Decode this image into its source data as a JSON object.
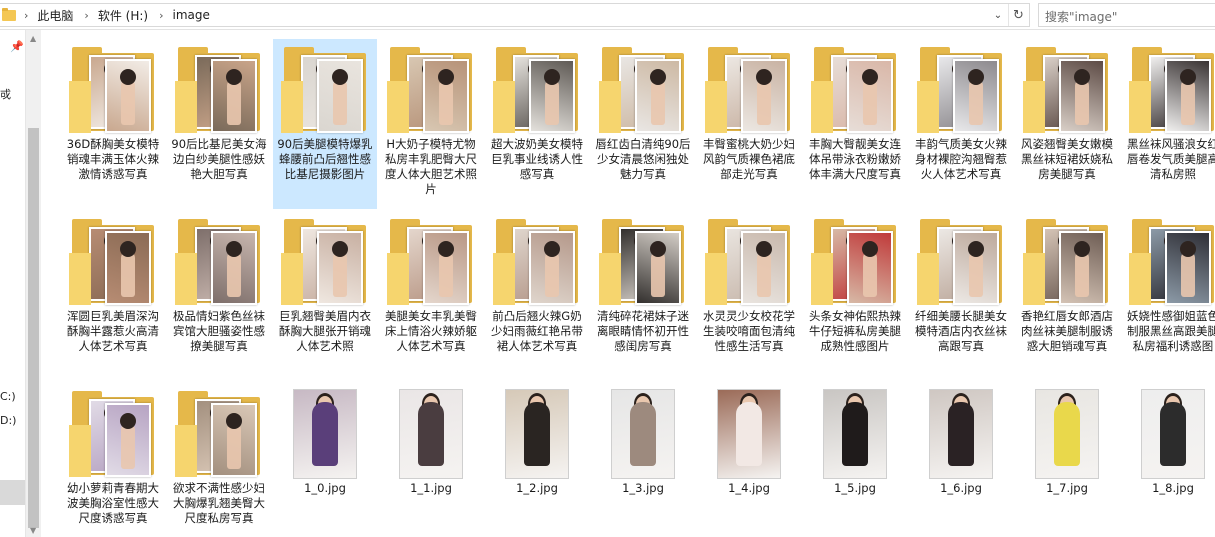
{
  "address": {
    "crumbs": [
      "此电脑",
      "软件 (H:)",
      "image"
    ],
    "search_placeholder": "搜索\"image\""
  },
  "nav": {
    "fragments": [
      {
        "text": "戓"
      },
      {
        "text": "C:)"
      },
      {
        "text": "D:)"
      }
    ]
  },
  "items": [
    {
      "type": "folder",
      "label": "36D酥胸美女模特销魂丰满玉体火辣激情诱惑写真",
      "colors": [
        "#c9a88f",
        "#f2ece6"
      ]
    },
    {
      "type": "folder",
      "label": "90后比基尼美女海边白纱美腿性感妖艳大胆写真",
      "colors": [
        "#7a6a5a",
        "#c9a489"
      ]
    },
    {
      "type": "folder",
      "label": "90后美腿模特爆乳蜂腰前凸后翘性感比基尼摄影图片",
      "colors": [
        "#dad6d0",
        "#e9e4de"
      ],
      "selected": true
    },
    {
      "type": "folder",
      "label": "H大奶子模特尤物私房丰乳肥臀大尺度人体大胆艺术照片",
      "colors": [
        "#d8c7b2",
        "#b79379"
      ]
    },
    {
      "type": "folder",
      "label": "超大波奶美女模特巨乳事业线诱人性感写真",
      "colors": [
        "#e4e1dc",
        "#5f5a55"
      ]
    },
    {
      "type": "folder",
      "label": "唇红齿白清纯90后少女清晨悠闲独处魅力写真",
      "colors": [
        "#e9e6e3",
        "#cdb9a4"
      ]
    },
    {
      "type": "folder",
      "label": "丰臀蜜桃大奶少妇风韵气质裸色裙底部走光写真",
      "colors": [
        "#ece7e2",
        "#c9b3a3"
      ]
    },
    {
      "type": "folder",
      "label": "丰胸大臀靓美女连体吊带泳衣粉嫩娇体丰满大尺度写真",
      "colors": [
        "#e7ddd7",
        "#d9b7a8"
      ]
    },
    {
      "type": "folder",
      "label": "丰韵气质美女火辣身材裸腔沟翘臀惹火人体艺术写真",
      "colors": [
        "#e8e8ea",
        "#8d8a8e"
      ]
    },
    {
      "type": "folder",
      "label": "风姿翘臀美女嫩模黑丝袜短裙妖娆私房美腿写真",
      "colors": [
        "#d9cfc7",
        "#5d4b45"
      ]
    },
    {
      "type": "folder",
      "label": "黑丝袜风骚浪女红唇卷发气质美腿高清私房照",
      "colors": [
        "#f0efee",
        "#3a3434"
      ]
    },
    {
      "type": "folder",
      "label": "浑圆巨乳美眉深沟酥胸半露惹火高清人体艺术写真",
      "colors": [
        "#b78c73",
        "#8b6b55"
      ]
    },
    {
      "type": "folder",
      "label": "极品情妇紫色丝袜宾馆大胆骚姿性感撩美腿写真",
      "colors": [
        "#7e6f6b",
        "#c7b5ad"
      ]
    },
    {
      "type": "folder",
      "label": "巨乳翘臀美眉内衣酥胸大腿张开销魂人体艺术照",
      "colors": [
        "#efe7e0",
        "#c8b0a2"
      ]
    },
    {
      "type": "folder",
      "label": "美腿美女丰乳美臀床上情浴火辣娇躯人体艺术写真",
      "colors": [
        "#e4d6cc",
        "#b99886"
      ]
    },
    {
      "type": "folder",
      "label": "前凸后翘火辣G奶少妇雨薇红艳吊带裙人体艺术写真",
      "colors": [
        "#dfd5cc",
        "#b5998b"
      ]
    },
    {
      "type": "folder",
      "label": "清纯碎花裙妹子迷离眼睛情怀初开性感闺房写真",
      "colors": [
        "#33302e",
        "#d3cdc6"
      ]
    },
    {
      "type": "folder",
      "label": "水灵灵少女校花学生装咬唷面包清纯性感生活写真",
      "colors": [
        "#e9e4df",
        "#c9b9ad"
      ]
    },
    {
      "type": "folder",
      "label": "头条女神佑熙热辣牛仔短裤私房美腿成熟性感图片",
      "colors": [
        "#d7b9a6",
        "#c03a3a"
      ]
    },
    {
      "type": "folder",
      "label": "纤细美腰长腿美女模特酒店内衣丝袜高跟写真",
      "colors": [
        "#ece8e4",
        "#bda99c"
      ]
    },
    {
      "type": "folder",
      "label": "香艳红唇女郎酒店肉丝袜美腿制服诱惑大胆销魂写真",
      "colors": [
        "#d4c3b5",
        "#6f5e55"
      ]
    },
    {
      "type": "folder",
      "label": "妖娆性感御姐蓝色制服黑丝高跟美腿私房福利诱惑图",
      "colors": [
        "#8c9aa7",
        "#2f2f36"
      ]
    },
    {
      "type": "folder",
      "label": "幼小萝莉青春期大波美胸浴室性感大尺度诱惑写真",
      "colors": [
        "#e1dbe6",
        "#b7a4c3"
      ]
    },
    {
      "type": "folder",
      "label": "欲求不满性感少妇大胸爆乳翘美臀大尺度私房写真",
      "colors": [
        "#a3907f",
        "#d9c7b6"
      ]
    },
    {
      "type": "image",
      "label": "1_0.jpg",
      "colors": [
        "#c7b9c4",
        "#5a3f7a"
      ]
    },
    {
      "type": "image",
      "label": "1_1.jpg",
      "colors": [
        "#eae6e6",
        "#4a3d40"
      ]
    },
    {
      "type": "image",
      "label": "1_2.jpg",
      "colors": [
        "#d6c9b8",
        "#2a2522"
      ]
    },
    {
      "type": "image",
      "label": "1_3.jpg",
      "colors": [
        "#e6e6e6",
        "#9d8a7e"
      ]
    },
    {
      "type": "image",
      "label": "1_4.jpg",
      "colors": [
        "#9b6b58",
        "#f2e8e4"
      ]
    },
    {
      "type": "image",
      "label": "1_5.jpg",
      "colors": [
        "#c9c6c3",
        "#1f1b1b"
      ]
    },
    {
      "type": "image",
      "label": "1_6.jpg",
      "colors": [
        "#cfc7c2",
        "#2a2224"
      ]
    },
    {
      "type": "image",
      "label": "1_7.jpg",
      "colors": [
        "#e8e6e2",
        "#e9d84b"
      ]
    },
    {
      "type": "image",
      "label": "1_8.jpg",
      "colors": [
        "#eeeeee",
        "#2c2c2c"
      ]
    }
  ]
}
